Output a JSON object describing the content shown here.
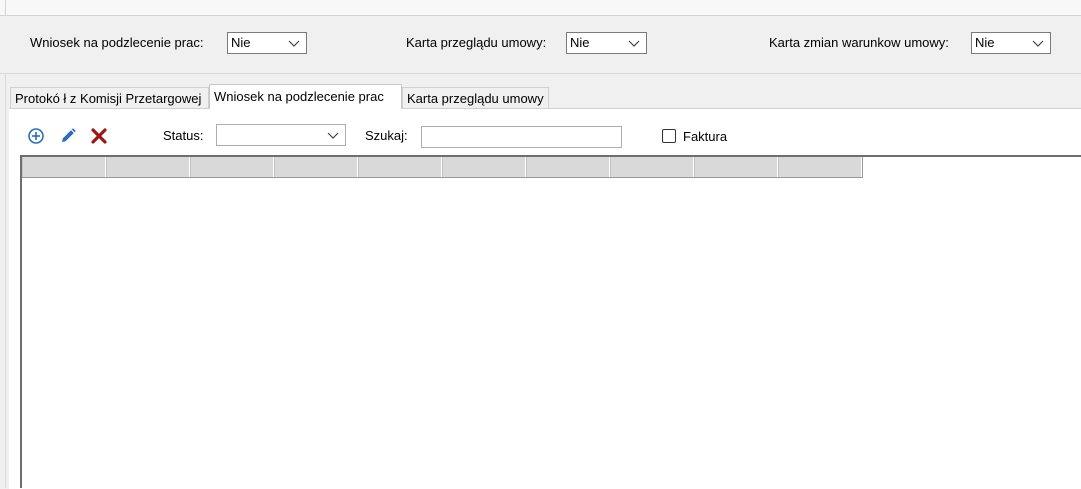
{
  "header": {
    "fields": [
      {
        "label": "Wniosek na podzlecenie prac:",
        "value": "Nie"
      },
      {
        "label": "Karta przeglądu umowy:",
        "value": "Nie"
      },
      {
        "label": "Karta zmian warunkow umowy:",
        "value": "Nie"
      }
    ]
  },
  "tabs": [
    {
      "label": "Protokó ł z Komisji Przetargowej"
    },
    {
      "label": "Wniosek na podzlecenie prac"
    },
    {
      "label": "Karta przeglądu umowy"
    }
  ],
  "toolbar": {
    "icons": [
      "add-circle-icon",
      "edit-pencil-icon",
      "delete-x-icon"
    ],
    "status_label": "Status:",
    "status_value": "",
    "search_label": "Szukaj:",
    "search_value": "",
    "invoice_label": "Faktura",
    "invoice_checked": false
  },
  "grid": {
    "columns": [
      "",
      "",
      "",
      "",
      "",
      "",
      "",
      "",
      "",
      ""
    ],
    "rows": []
  },
  "colors": {
    "icon_blue": "#2a6ebb",
    "delete_red": "#a31515"
  }
}
